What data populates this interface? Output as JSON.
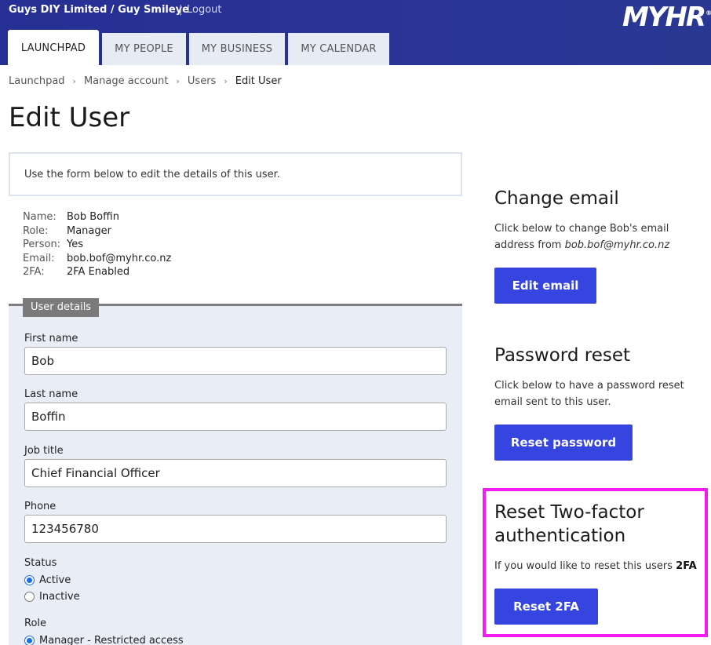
{
  "header": {
    "company": "Guys DIY Limited / Guy Smileye",
    "separator": "|",
    "logout": "Logout",
    "logo": "MYHR",
    "logo_mark": "®"
  },
  "tabs": [
    {
      "label": "LAUNCHPAD",
      "active": true
    },
    {
      "label": "MY PEOPLE",
      "active": false
    },
    {
      "label": "MY BUSINESS",
      "active": false
    },
    {
      "label": "MY CALENDAR",
      "active": false
    }
  ],
  "breadcrumb": {
    "items": [
      "Launchpad",
      "Manage account",
      "Users",
      "Edit User"
    ],
    "separator": "›"
  },
  "page_title": "Edit User",
  "intro": "Use the form below to edit the details of this user.",
  "user_info": [
    {
      "key": "Name:",
      "value": "Bob Boffin"
    },
    {
      "key": "Role:",
      "value": "Manager"
    },
    {
      "key": "Person:",
      "value": "Yes"
    },
    {
      "key": "Email:",
      "value": "bob.bof@myhr.co.nz"
    },
    {
      "key": "2FA:",
      "value": "2FA Enabled"
    }
  ],
  "form": {
    "legend": "User details",
    "first_name_label": "First name",
    "first_name": "Bob",
    "last_name_label": "Last name",
    "last_name": "Boffin",
    "job_title_label": "Job title",
    "job_title": "Chief Financial Officer",
    "phone_label": "Phone",
    "phone": "123456780",
    "status_label": "Status",
    "status_active": "Active",
    "status_inactive": "Inactive",
    "role_label": "Role",
    "role_option": "Manager - Restricted access"
  },
  "change_email": {
    "title": "Change email",
    "text_prefix": "Click below to change Bob's email address from ",
    "email": "bob.bof@myhr.co.nz",
    "button": "Edit email"
  },
  "password_reset": {
    "title": "Password reset",
    "text": "Click below to have a password reset email sent to this user.",
    "button": "Reset password"
  },
  "two_factor": {
    "title": "Reset Two-factor authentication",
    "text_prefix": "If you would like to reset this users ",
    "text_bold": "2FA",
    "button": "Reset 2FA"
  },
  "colors": {
    "header": "#262f93",
    "button": "#3644e0",
    "highlight": "#f21cf0",
    "fieldset_bg": "#e9eef6"
  }
}
